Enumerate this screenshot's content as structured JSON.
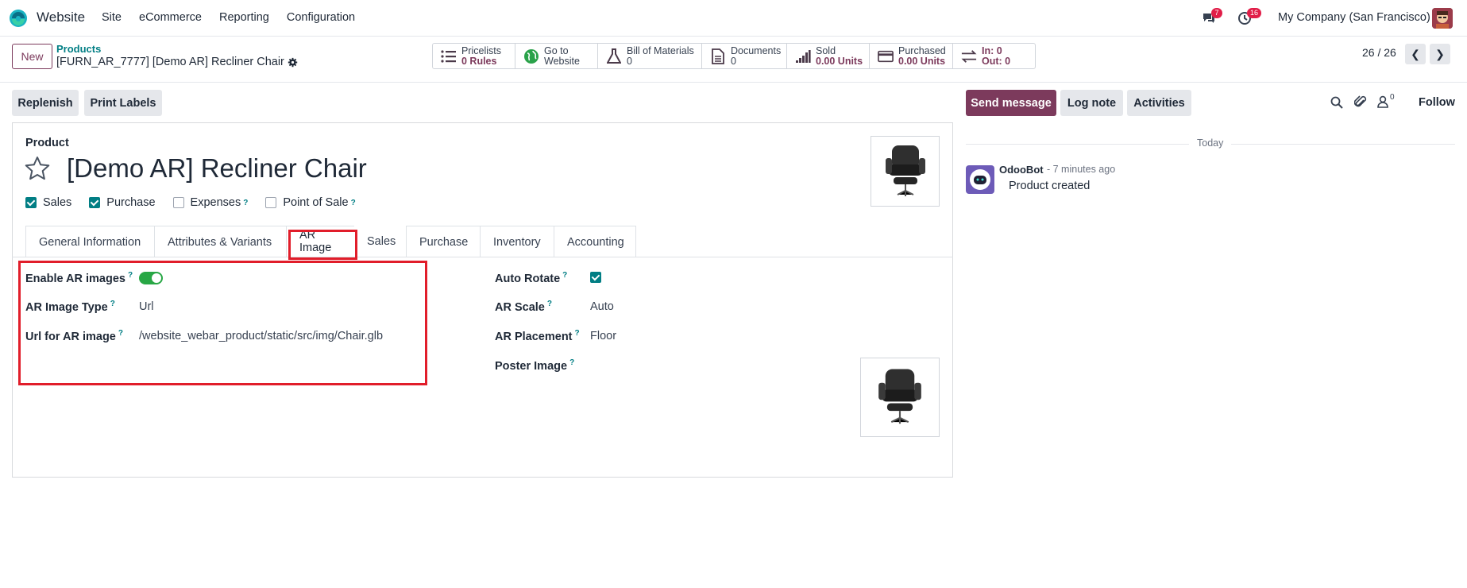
{
  "navbar": {
    "app_name": "Website",
    "menu": [
      "Site",
      "eCommerce",
      "Reporting",
      "Configuration"
    ],
    "messages_badge": "7",
    "activities_badge": "16",
    "company": "My Company (San Francisco)"
  },
  "control_panel": {
    "new_label": "New",
    "breadcrumb_parent": "Products",
    "breadcrumb_current": "[FURN_AR_7777] [Demo AR] Recliner Chair",
    "stats": [
      {
        "title": "Pricelists",
        "value": "0 Rules",
        "icon": "list-icon"
      },
      {
        "title": "Go to",
        "value": "Website",
        "icon": "globe-icon"
      },
      {
        "title": "Bill of Materials",
        "value": "0",
        "icon": "flask-icon"
      },
      {
        "title": "Documents",
        "value": "0",
        "icon": "document-icon"
      },
      {
        "title": "Sold",
        "value": "0.00 Units",
        "icon": "signal-icon"
      },
      {
        "title": "Purchased",
        "value": "0.00 Units",
        "icon": "credit-card-icon"
      },
      {
        "title": "In: 0",
        "value": "Out: 0",
        "icon": "exchange-icon"
      }
    ],
    "pager": "26 / 26"
  },
  "actions": {
    "replenish": "Replenish",
    "print_labels": "Print Labels"
  },
  "form": {
    "product_label": "Product",
    "title": "[Demo AR] Recliner Chair",
    "checkboxes": [
      {
        "label": "Sales",
        "checked": true,
        "help": ""
      },
      {
        "label": "Purchase",
        "checked": true,
        "help": ""
      },
      {
        "label": "Expenses",
        "checked": false,
        "help": "?"
      },
      {
        "label": "Point of Sale",
        "checked": false,
        "help": "?"
      }
    ],
    "tabs": [
      "General Information",
      "Attributes & Variants",
      "AR Image",
      "Sales",
      "Purchase",
      "Inventory",
      "Accounting"
    ],
    "active_tab": "AR Image",
    "fields": {
      "enable_ar_label": "Enable AR images",
      "ar_type_label": "AR Image Type",
      "ar_type_value": "Url",
      "ar_url_label": "Url for AR image",
      "ar_url_value": "/website_webar_product/static/src/img/Chair.glb",
      "auto_rotate_label": "Auto Rotate",
      "ar_scale_label": "AR Scale",
      "ar_scale_value": "Auto",
      "ar_placement_label": "AR Placement",
      "ar_placement_value": "Floor",
      "poster_label": "Poster Image",
      "help": "?"
    }
  },
  "chatter": {
    "send_message": "Send message",
    "log_note": "Log note",
    "activities": "Activities",
    "followers_count": "0",
    "follow": "Follow",
    "today": "Today",
    "author": "OdooBot",
    "time": "- 7 minutes ago",
    "message": "Product created"
  },
  "colors": {
    "brand": "#7c3a5c",
    "accent": "#017e84",
    "highlight": "#e11d2a"
  }
}
